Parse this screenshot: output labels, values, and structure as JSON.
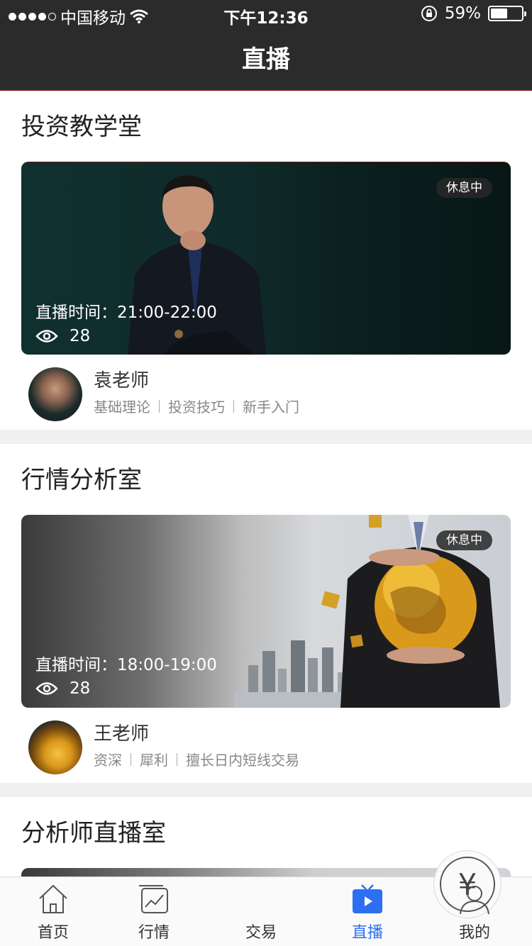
{
  "status_bar": {
    "carrier": "中国移动",
    "time": "下午12:36",
    "battery_pct": "59%",
    "battery_level": 0.59
  },
  "nav": {
    "title": "直播"
  },
  "sections": [
    {
      "title": "投资教学堂",
      "card": {
        "status_badge": "休息中",
        "live_time": "直播时间：21:00-22:00",
        "views": "28"
      },
      "teacher": {
        "name": "袁老师",
        "tags": [
          "基础理论",
          "投资技巧",
          "新手入门"
        ]
      }
    },
    {
      "title": "行情分析室",
      "card": {
        "status_badge": "休息中",
        "live_time": "直播时间：18:00-19:00",
        "views": "28"
      },
      "teacher": {
        "name": "王老师",
        "tags": [
          "资深",
          "犀利",
          "擅长日内短线交易"
        ]
      }
    },
    {
      "title": "分析师直播室"
    }
  ],
  "tabbar": {
    "tabs": [
      {
        "label": "首页",
        "icon": "home-icon"
      },
      {
        "label": "行情",
        "icon": "market-chart-icon"
      },
      {
        "label": "交易",
        "icon": "yen-icon"
      },
      {
        "label": "直播",
        "icon": "live-tv-icon",
        "active": true
      },
      {
        "label": "我的",
        "icon": "profile-icon"
      }
    ],
    "trade_symbol": "¥",
    "active_color": "#2d6ff0"
  }
}
